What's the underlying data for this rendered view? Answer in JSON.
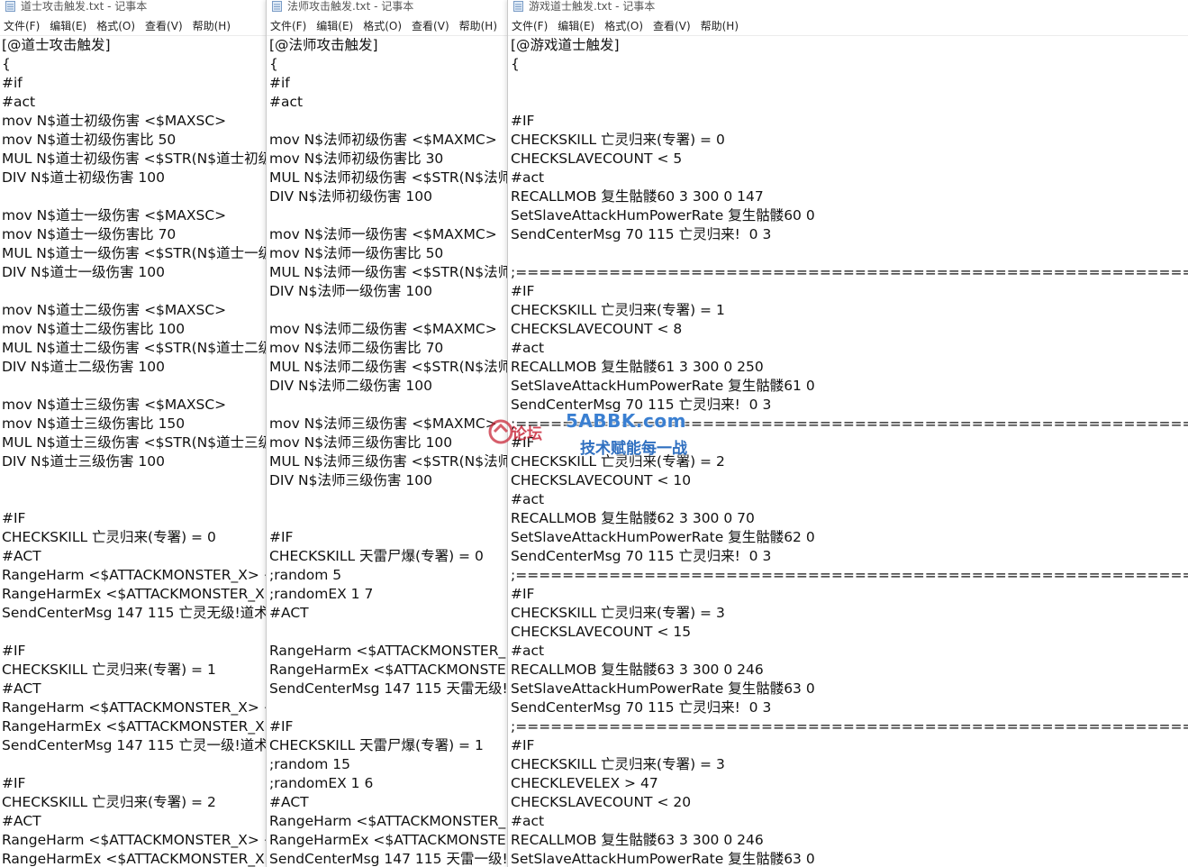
{
  "menu": [
    "文件(F)",
    "编辑(E)",
    "格式(O)",
    "查看(V)",
    "帮助(H)"
  ],
  "windows": [
    {
      "title": "道士攻击触发.txt - 记事本",
      "lines": [
        "[@道士攻击触发]",
        "{",
        "#if",
        "#act",
        "mov N$道士初级伤害 <$MAXSC>",
        "mov N$道士初级伤害比 50",
        "MUL N$道士初级伤害 <$STR(N$道士初级",
        "DIV N$道士初级伤害 100",
        "",
        "mov N$道士一级伤害 <$MAXSC>",
        "mov N$道士一级伤害比 70",
        "MUL N$道士一级伤害 <$STR(N$道士一级",
        "DIV N$道士一级伤害 100",
        "",
        "mov N$道士二级伤害 <$MAXSC>",
        "mov N$道士二级伤害比 100",
        "MUL N$道士二级伤害 <$STR(N$道士二级",
        "DIV N$道士二级伤害 100",
        "",
        "mov N$道士三级伤害 <$MAXSC>",
        "mov N$道士三级伤害比 150",
        "MUL N$道士三级伤害 <$STR(N$道士三级",
        "DIV N$道士三级伤害 100",
        "",
        "",
        "#IF",
        "CHECKSKILL 亡灵归来(专署) = 0",
        "#ACT",
        "RangeHarm <$ATTACKMONSTER_X> <",
        "RangeHarmEx <$ATTACKMONSTER_X:",
        "SendCenterMsg 147 115 亡灵无级!道术",
        "",
        "#IF",
        "CHECKSKILL 亡灵归来(专署) = 1",
        "#ACT",
        "RangeHarm <$ATTACKMONSTER_X> <",
        "RangeHarmEx <$ATTACKMONSTER_X:",
        "SendCenterMsg 147 115 亡灵一级!道术",
        "",
        "#IF",
        "CHECKSKILL 亡灵归来(专署) = 2",
        "#ACT",
        "RangeHarm <$ATTACKMONSTER_X> <",
        "RangeHarmEx <$ATTACKMONSTER_X:"
      ]
    },
    {
      "title": "法师攻击触发.txt - 记事本",
      "lines": [
        "[@法师攻击触发]",
        "{",
        "#if",
        "#act",
        "",
        "mov N$法师初级伤害 <$MAXMC>",
        "mov N$法师初级伤害比 30",
        "MUL N$法师初级伤害 <$STR(N$法师",
        "DIV N$法师初级伤害 100",
        "",
        "mov N$法师一级伤害 <$MAXMC>",
        "mov N$法师一级伤害比 50",
        "MUL N$法师一级伤害 <$STR(N$法师",
        "DIV N$法师一级伤害 100",
        "",
        "mov N$法师二级伤害 <$MAXMC>",
        "mov N$法师二级伤害比 70",
        "MUL N$法师二级伤害 <$STR(N$法师",
        "DIV N$法师二级伤害 100",
        "",
        "mov N$法师三级伤害 <$MAXMC>",
        "mov N$法师三级伤害比 100",
        "MUL N$法师三级伤害 <$STR(N$法师",
        "DIV N$法师三级伤害 100",
        "",
        "",
        "#IF",
        "CHECKSKILL 天雷尸爆(专署) = 0",
        ";random 5",
        ";randomEX 1 7",
        "#ACT",
        "",
        "RangeHarm <$ATTACKMONSTER_",
        "RangeHarmEx <$ATTACKMONSTE",
        "SendCenterMsg 147 115 天雷无级!",
        "",
        "#IF",
        "CHECKSKILL 天雷尸爆(专署) = 1",
        ";random 15",
        ";randomEX 1 6",
        "#ACT",
        "RangeHarm <$ATTACKMONSTER_",
        "RangeHarmEx <$ATTACKMONSTE",
        "SendCenterMsg 147 115 天雷一级!"
      ]
    },
    {
      "title": "游戏道士触发.txt - 记事本",
      "lines": [
        "[@游戏道士触发]",
        "{",
        "",
        "",
        "#IF",
        "CHECKSKILL 亡灵归来(专署) = 0",
        "CHECKSLAVECOUNT < 5",
        "#act",
        "RECALLMOB 复生骷髅60 3 300 0 147",
        "SetSlaveAttackHumPowerRate 复生骷髅60 0",
        "SendCenterMsg 70 115 亡灵归来!  0 3",
        "",
        ";============================================================================",
        "#IF",
        "CHECKSKILL 亡灵归来(专署) = 1",
        "CHECKSLAVECOUNT < 8",
        "#act",
        "RECALLMOB 复生骷髅61 3 300 0 250",
        "SetSlaveAttackHumPowerRate 复生骷髅61 0",
        "SendCenterMsg 70 115 亡灵归来!  0 3",
        ";============================================================================",
        "#IF",
        "CHECKSKILL 亡灵归来(专署) = 2",
        "CHECKSLAVECOUNT < 10",
        "#act",
        "RECALLMOB 复生骷髅62 3 300 0 70",
        "SetSlaveAttackHumPowerRate 复生骷髅62 0",
        "SendCenterMsg 70 115 亡灵归来!  0 3",
        ";============================================================================",
        "#IF",
        "CHECKSKILL 亡灵归来(专署) = 3",
        "CHECKSLAVECOUNT < 15",
        "#act",
        "RECALLMOB 复生骷髅63 3 300 0 246",
        "SetSlaveAttackHumPowerRate 复生骷髅63 0",
        "SendCenterMsg 70 115 亡灵归来!  0 3",
        ";============================================================================",
        "#IF",
        "CHECKSKILL 亡灵归来(专署) = 3",
        "CHECKLEVELEX > 47",
        "CHECKSLAVECOUNT < 20",
        "#act",
        "RECALLMOB 复生骷髅63 3 300 0 246",
        "SetSlaveAttackHumPowerRate 复生骷髅63 0"
      ]
    }
  ],
  "watermark": {
    "site": "5ABBK.com",
    "slogan": "技术赋能每一战",
    "forum": "论坛"
  }
}
